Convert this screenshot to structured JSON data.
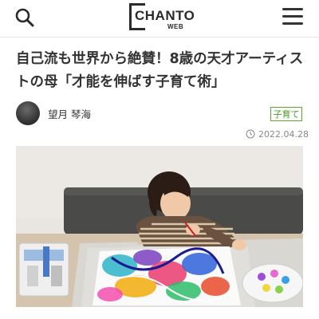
{
  "header": {
    "logo_text": "CHANTO",
    "logo_sub": "WEB",
    "icons": {
      "search": "search-icon",
      "menu": "hamburger-menu-icon"
    }
  },
  "article": {
    "title": "自己流も世界から絶賛！8歳の天才アーティストの母「才能を伸ばす子育て術」",
    "author": "望月 琴海",
    "tag": "子育て",
    "date": "2022.04.28"
  },
  "colors": {
    "tag_accent": "#5aa832",
    "text": "#333333",
    "date_text": "#888888"
  }
}
